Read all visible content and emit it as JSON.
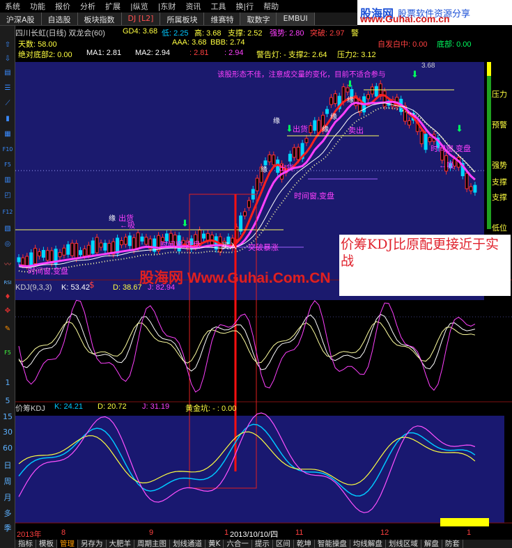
{
  "menu": [
    "系统",
    "功能",
    "报价",
    "分析",
    "扩展",
    "|纵览",
    "|东财",
    "资讯",
    "工具",
    "换|行",
    "帮助"
  ],
  "brand": {
    "logo": "股海网",
    "slogan": "股票软件资源分享",
    "url": "www.Guhai.com.cn"
  },
  "tabs": [
    {
      "label": "沪深A股",
      "active": false
    },
    {
      "label": "自选股",
      "active": false
    },
    {
      "label": "板块指数",
      "active": false
    },
    {
      "label": "DJ [L2]",
      "active": true
    },
    {
      "label": "所属板块",
      "active": false
    },
    {
      "label": "维赛特",
      "active": false
    },
    {
      "label": "取数字",
      "active": false
    },
    {
      "label": "EMBUI",
      "active": false
    }
  ],
  "toolbar_numbers": [
    "1",
    "5",
    "15",
    "30",
    "60",
    "日",
    "周",
    "月",
    "多",
    "季"
  ],
  "toolbar_icons": [
    "up-arrow-icon",
    "down-arrow-icon",
    "book-icon",
    "list-icon",
    "chart-icon",
    "candle-icon",
    "grid-icon",
    "f10-icon",
    "f5-icon",
    "f12-icon",
    "circle-icon",
    "ruler-icon",
    "rsi-icon",
    "settings-icon",
    "move-icon",
    "pencil-icon",
    "f5b-icon"
  ],
  "toolbar_labels": {
    "f10": "F10",
    "f5": "F5",
    "f12": "F12",
    "rsi": "RSI",
    "f5b": "F5"
  },
  "header": {
    "stock": "四川长虹(日线) 双龙会(60)",
    "gd4": "GD4: 3.68",
    "low": "低: 2.25",
    "high": "高: 3.68",
    "support": "支撑: 2.52",
    "strength": "强势: 2.80",
    "break": "突破: 2.97",
    "warn": "警",
    "days": "天数: 58.00",
    "aaa": "AAA: 3.68",
    "bbb": "BBB: 2.74",
    "top_state": "自发白中: 0.00",
    "bottom": "底部: 0.00",
    "abs_bottom": "绝对底部2: 0.00",
    "ma1": "MA1: 2.81",
    "ma2": "MA2: 2.94",
    "v1": ": 2.81",
    "v2": ": 2.94",
    "alert": "警告灯: - 支撑2: 2.64",
    "pressure": "压力2: 3.12"
  },
  "main_notes": {
    "comment": "该股形态不佳，注意成交量的变化，目前不适合参与",
    "high_price": "3.68",
    "out1": "出货",
    "out2": "出货",
    "out3": "出货",
    "out4": "卖出",
    "window1": "时间窗,变盘",
    "window2": "时间窗,变盘",
    "window3": "时间窗,变盘",
    "window4": "时间窗,变盘",
    "buy": "买入",
    "breakout": "突破暴涨",
    "absorb": "←吸",
    "absorb2": "←吸",
    "vert_labels": [
      "缘",
      "缘",
      "缘",
      "缘",
      "缘",
      "缘"
    ],
    "right_labels": [
      "压力",
      "预警",
      "强势",
      "支撑",
      "支撑",
      "低位"
    ]
  },
  "kdj": {
    "title": "KDJ(9,3,3)",
    "k": "K: 53.42",
    "d": "D: 38.67",
    "j": "J: 82.94"
  },
  "jckdj": {
    "title": "价筹KDJ",
    "k": "K: 24.21",
    "d": "D: 20.72",
    "j": "J: 31.19",
    "pit": "黄金坑: - : 0.00"
  },
  "timeline": {
    "year": "2013年",
    "m8": "8",
    "m9": "9",
    "m10": "1",
    "date": "2013/10/10/四",
    "m11": "11",
    "m12": "12",
    "m1": "1"
  },
  "annotation": "价筹KDJ比原配更接近于实战",
  "watermark": {
    "brand": "股海网",
    "url": "Www.Guhai.Com.CN"
  },
  "bottom_tabs": [
    "指标",
    "模板",
    "管理",
    "另存为",
    "大肥羊",
    "周期主图",
    "划线通道",
    "黄K",
    "六合一",
    "提示",
    "区间",
    "乾坤",
    "智能操盘",
    "均线解盘",
    "划线区域",
    "解盘",
    "防套"
  ],
  "bottom_active": "管理",
  "colors": {
    "red": "#ff3030",
    "magenta": "#ff40ff",
    "yellow": "#ffff00",
    "cyan": "#00e0ff",
    "green": "#00ff40",
    "panel": "#1a1a6e"
  }
}
